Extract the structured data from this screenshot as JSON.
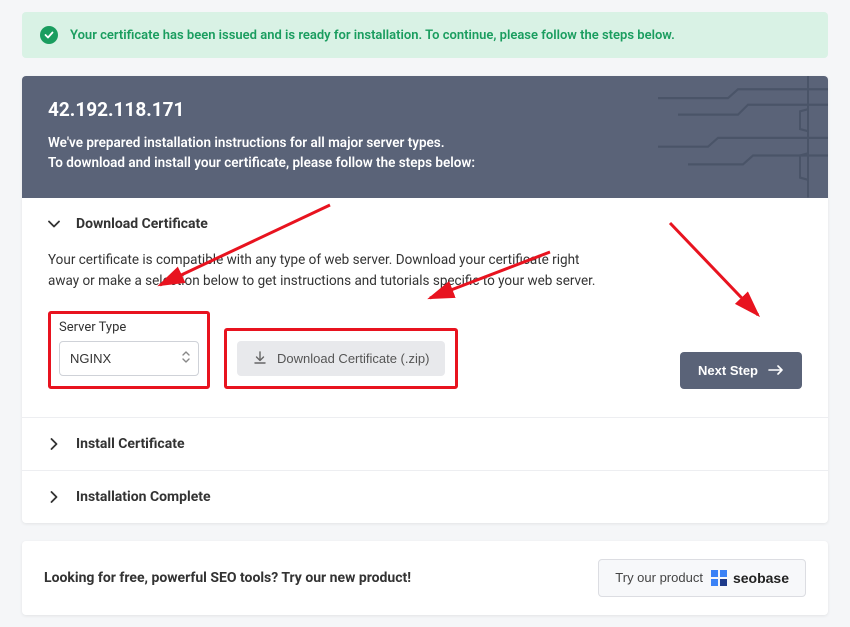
{
  "alert": {
    "message": "Your certificate has been issued and is ready for installation. To continue, please follow the steps below."
  },
  "header": {
    "ip": "42.192.118.171",
    "line1": "We've prepared installation instructions for all major server types.",
    "line2": "To download and install your certificate, please follow the steps below:"
  },
  "accordion": {
    "download": {
      "title": "Download Certificate",
      "desc": "Your certificate is compatible with any type of web server. Download your certificate right away or make a selection below to get instructions and tutorials specific to your web server.",
      "serverTypeLabel": "Server Type",
      "serverTypeValue": "NGINX",
      "downloadBtn": "Download Certificate (.zip)",
      "nextBtn": "Next Step"
    },
    "install": {
      "title": "Install Certificate"
    },
    "complete": {
      "title": "Installation Complete"
    }
  },
  "promo": {
    "text": "Looking for free, powerful SEO tools? Try our new product!",
    "btnPrefix": "Try our product",
    "brand": "seobase"
  },
  "colors": {
    "accent": "#5a6378",
    "successBg": "#d9f2e5",
    "success": "#1a9d5f",
    "annotation": "#e8131f"
  }
}
